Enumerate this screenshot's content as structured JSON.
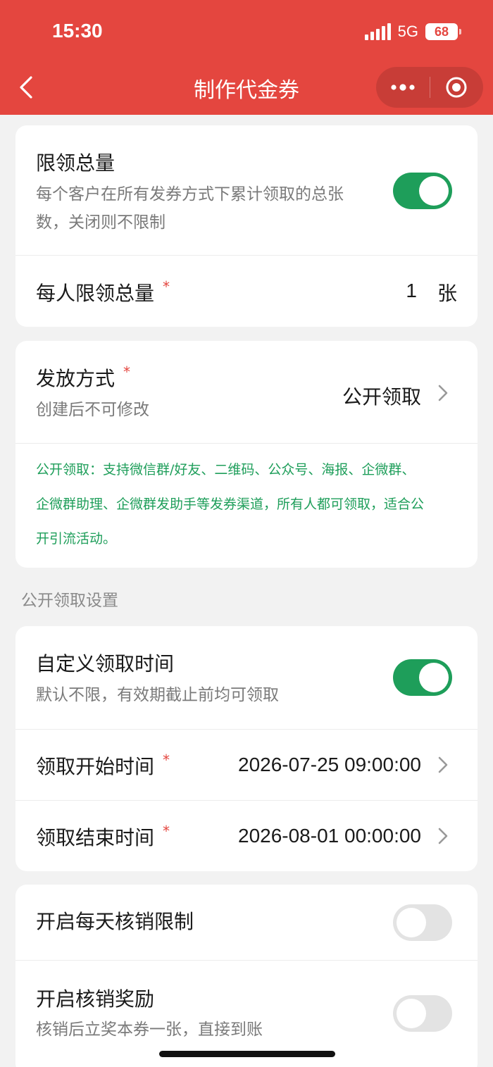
{
  "status_bar": {
    "time": "15:30",
    "network": "5G",
    "battery": "68"
  },
  "nav": {
    "title": "制作代金券"
  },
  "limit_card": {
    "toggle_title": "限领总量",
    "toggle_desc_line1": "每个客户在所有发券方式下累计领取的总张",
    "toggle_desc_line2": "数，关闭则不限制",
    "toggle_on": true,
    "per_person_label": "每人限领总量",
    "required_mark": "*",
    "per_person_value": "1",
    "per_person_unit": "张"
  },
  "distribution_card": {
    "label": "发放方式",
    "required_mark": "*",
    "sub": "创建后不可修改",
    "value": "公开领取",
    "tip_line1": "公开领取：支持微信群/好友、二维码、公众号、海报、企微群、",
    "tip_line2": "企微群助理、企微群发助手等发券渠道，所有人都可领取，适合公",
    "tip_line3": "开引流活动。"
  },
  "section_title": "公开领取设置",
  "time_card": {
    "toggle_title": "自定义领取时间",
    "toggle_desc": "默认不限，有效期截止前均可领取",
    "toggle_on": true,
    "start_label": "领取开始时间",
    "start_value": "2026-07-25 09:00:00",
    "end_label": "领取结束时间",
    "end_value": "2026-08-01 00:00:00",
    "required_mark": "*"
  },
  "redeem_card": {
    "daily_limit_label": "开启每天核销限制",
    "daily_limit_on": false,
    "reward_label": "开启核销奖励",
    "reward_desc": "核销后立奖本券一张，直接到账",
    "reward_on": false
  },
  "colors": {
    "brand_red": "#e4463f",
    "toggle_green": "#1e9e5a",
    "tip_green": "#1e9e5a"
  },
  "icons": [
    "back-chevron-icon",
    "more-dots-icon",
    "close-target-icon",
    "chevron-right-icon"
  ]
}
